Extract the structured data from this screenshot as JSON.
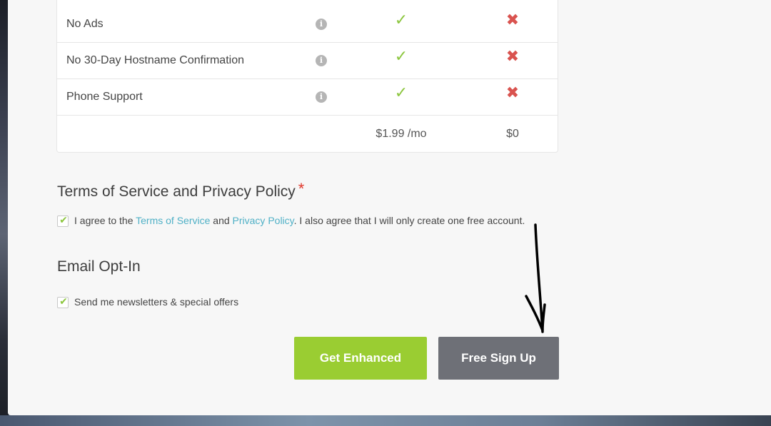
{
  "features": [
    {
      "label": "No Ads",
      "enhanced": "✓",
      "free": "✖"
    },
    {
      "label": "No 30-Day Hostname Confirmation",
      "enhanced": "✓",
      "free": "✖"
    },
    {
      "label": "Phone Support",
      "enhanced": "✓",
      "free": "✖"
    }
  ],
  "pricing": {
    "enhanced": "$1.99 /mo",
    "free": "$0"
  },
  "info_icon": "i",
  "terms": {
    "title": "Terms of Service and Privacy Policy",
    "required_mark": "*",
    "text_before": "I agree to the ",
    "tos_link": "Terms of Service",
    "text_and": " and ",
    "privacy_link": "Privacy Policy",
    "text_after": ". I also agree that I will only create one free account.",
    "checked": true
  },
  "email_optin": {
    "title": "Email Opt-In",
    "text": "Send me newsletters & special offers",
    "checked": true
  },
  "buttons": {
    "enhanced": "Get Enhanced",
    "free": "Free Sign Up"
  },
  "colors": {
    "accent_green": "#9acd32",
    "button_grey": "#6e7077",
    "link": "#4fb0c6",
    "cross_red": "#d9534f"
  }
}
